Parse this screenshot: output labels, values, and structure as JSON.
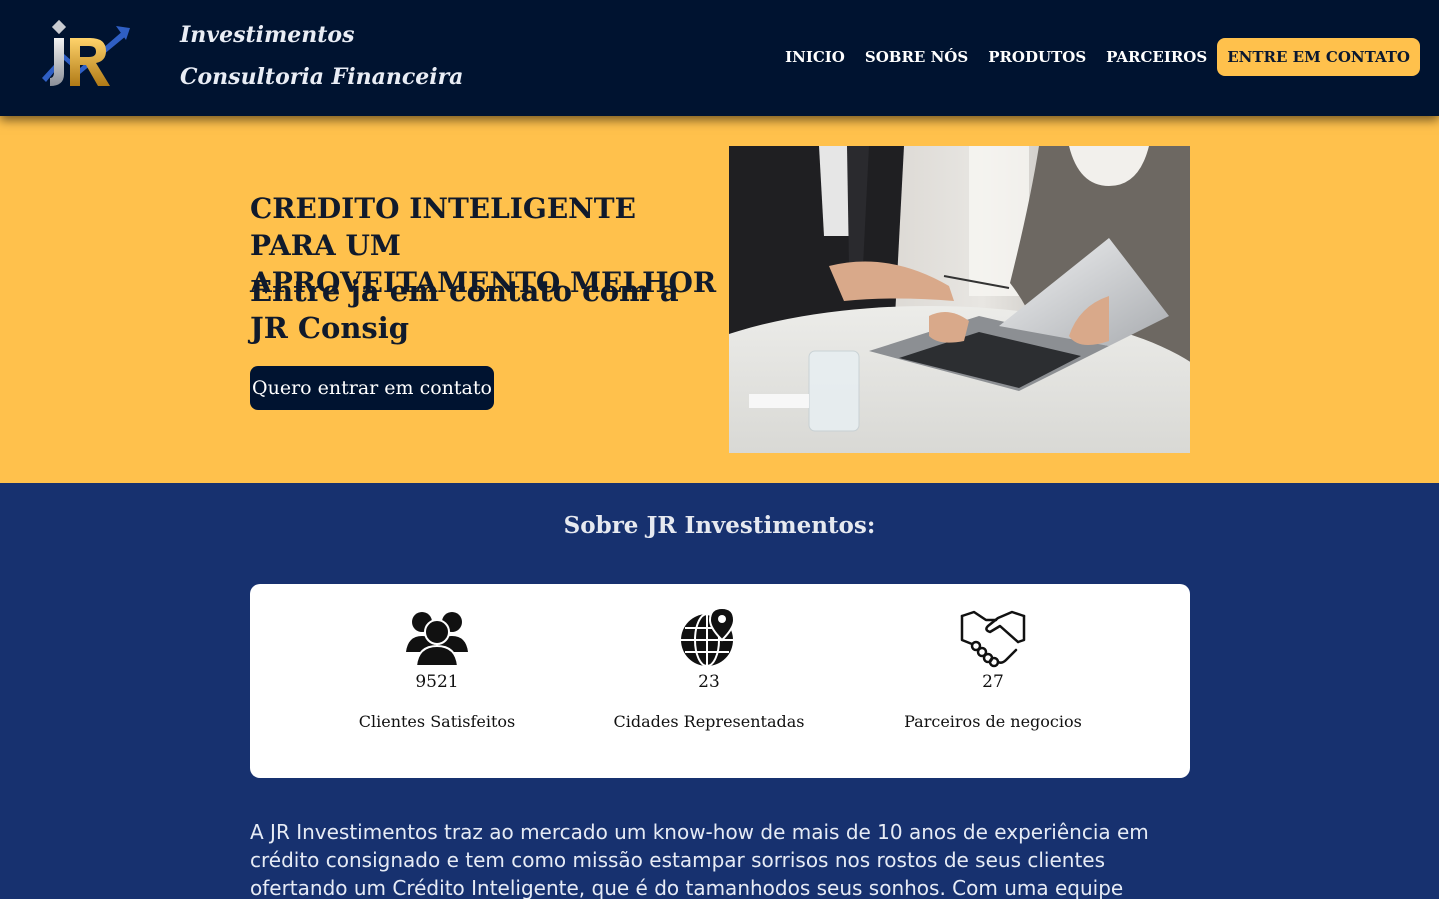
{
  "header": {
    "brand_line1": "Investimentos",
    "brand_line2": "Consultoria Financeira",
    "logo_text": "JR",
    "nav": {
      "inicio": "INICIO",
      "sobre": "SOBRE NÓS",
      "produtos": "PRODUTOS",
      "parceiros": "PARCEIROS",
      "contato": "ENTRE EM CONTATO"
    }
  },
  "hero": {
    "title": "CREDITO INTELIGENTE PARA UM APROVEITAMENTO MELHOR",
    "subtitle": "Entre ja em contato com a JR Consig",
    "button": "Quero entrar em contato"
  },
  "about": {
    "title": "Sobre JR Investimentos:",
    "stats": [
      {
        "icon": "users-icon",
        "value": "9521",
        "label": "Clientes Satisfeitos"
      },
      {
        "icon": "globe-location-icon",
        "value": "23",
        "label": "Cidades Representadas"
      },
      {
        "icon": "handshake-icon",
        "value": "27",
        "label": "Parceiros de negocios"
      }
    ],
    "text": "A JR Investimentos traz ao mercado um know-how de mais de 10 anos de experiência em crédito consignado e tem como missão estampar sorrisos nos rostos de seus clientes ofertando um Crédito Inteligente, que é do tamanhodos seus sonhos. Com uma equipe comprometida e prezando pelo"
  },
  "colors": {
    "header_bg": "#001330",
    "accent_yellow": "#ffc14c",
    "section_blue": "#17316f"
  }
}
